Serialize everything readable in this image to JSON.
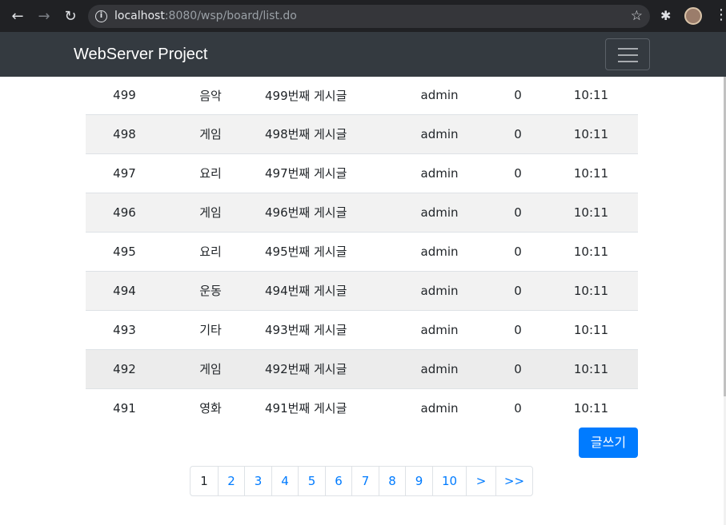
{
  "browser": {
    "url_host": "localhost",
    "url_rest": ":8080/wsp/board/list.do"
  },
  "navbar": {
    "brand": "WebServer Project"
  },
  "board": {
    "rows": [
      {
        "no": "499",
        "category": "음악",
        "title": "499번째 게시글",
        "writer": "admin",
        "hits": "0",
        "date": "10:11"
      },
      {
        "no": "498",
        "category": "게임",
        "title": "498번째 게시글",
        "writer": "admin",
        "hits": "0",
        "date": "10:11"
      },
      {
        "no": "497",
        "category": "요리",
        "title": "497번째 게시글",
        "writer": "admin",
        "hits": "0",
        "date": "10:11"
      },
      {
        "no": "496",
        "category": "게임",
        "title": "496번째 게시글",
        "writer": "admin",
        "hits": "0",
        "date": "10:11"
      },
      {
        "no": "495",
        "category": "요리",
        "title": "495번째 게시글",
        "writer": "admin",
        "hits": "0",
        "date": "10:11"
      },
      {
        "no": "494",
        "category": "운동",
        "title": "494번째 게시글",
        "writer": "admin",
        "hits": "0",
        "date": "10:11"
      },
      {
        "no": "493",
        "category": "기타",
        "title": "493번째 게시글",
        "writer": "admin",
        "hits": "0",
        "date": "10:11"
      },
      {
        "no": "492",
        "category": "게임",
        "title": "492번째 게시글",
        "writer": "admin",
        "hits": "0",
        "date": "10:11"
      },
      {
        "no": "491",
        "category": "영화",
        "title": "491번째 게시글",
        "writer": "admin",
        "hits": "0",
        "date": "10:11"
      }
    ]
  },
  "write_button": "글쓰기",
  "pagination": {
    "current": "1",
    "pages": [
      "1",
      "2",
      "3",
      "4",
      "5",
      "6",
      "7",
      "8",
      "9",
      "10"
    ],
    "next": ">",
    "last": ">>"
  },
  "colors": {
    "primary": "#007bff",
    "navbar": "#343a40",
    "stripe": "#f2f2f2"
  }
}
